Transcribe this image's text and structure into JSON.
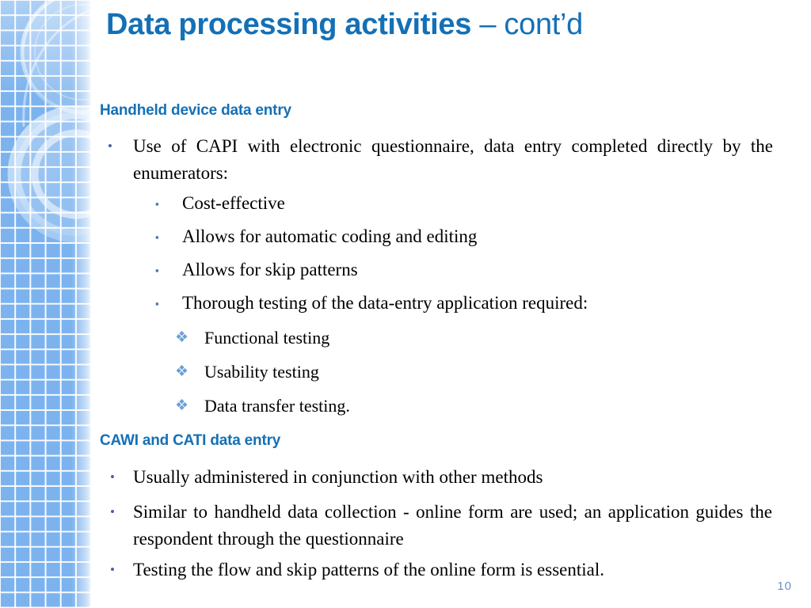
{
  "slide": {
    "title_main": "Data processing activities",
    "title_suffix": "– cont’d",
    "page_number": "10",
    "accent_color": "#1470b6",
    "sidebar_color": "#7cb3ee",
    "body_text_color": "#000000"
  },
  "sections": [
    {
      "heading": "Handheld device data entry",
      "bullets": [
        {
          "level": 1,
          "marker": "•",
          "text": "Use of CAPI with electronic questionnaire, data entry completed directly by the enumerators:"
        },
        {
          "level": 2,
          "marker": "▪",
          "text": "Cost-effective"
        },
        {
          "level": 2,
          "marker": "▪",
          "text": "Allows for automatic coding and editing"
        },
        {
          "level": 2,
          "marker": "▪",
          "text": "Allows for skip patterns"
        },
        {
          "level": 2,
          "marker": "▪",
          "text": "Thorough testing of the data-entry application required:"
        },
        {
          "level": 3,
          "marker": "❖",
          "text": "Functional testing"
        },
        {
          "level": 3,
          "marker": "❖",
          "text": "Usability testing"
        },
        {
          "level": 3,
          "marker": "❖",
          "text": "Data transfer testing."
        }
      ]
    },
    {
      "heading": "CAWI and CATI data entry",
      "bullets": [
        {
          "level": 1,
          "marker": "•",
          "text": "Usually administered in conjunction with other methods"
        },
        {
          "level": 1,
          "marker": "•",
          "text": "Similar to handheld data collection - online form are used; an application guides the respondent through the questionnaire"
        },
        {
          "level": 1,
          "marker": "•",
          "text": "Testing the flow and skip patterns of the online form is essential."
        }
      ]
    }
  ]
}
